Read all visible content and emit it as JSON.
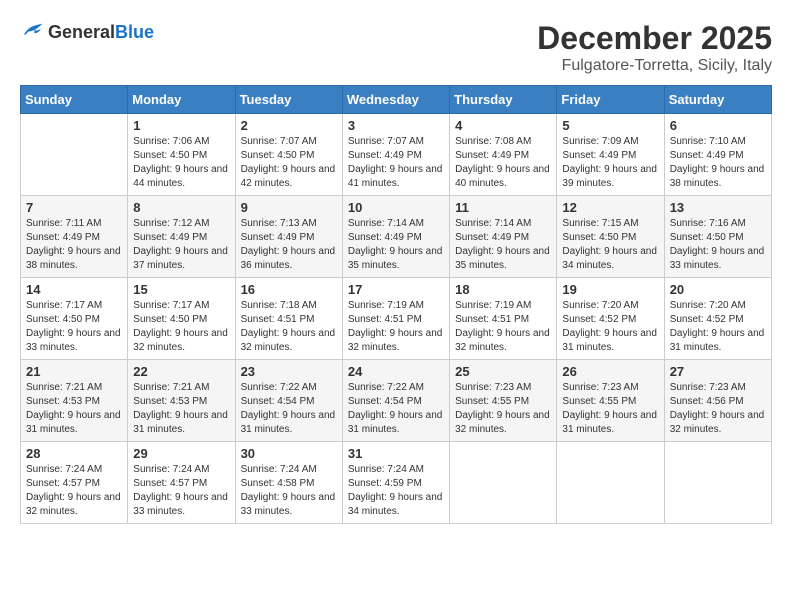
{
  "logo": {
    "general": "General",
    "blue": "Blue"
  },
  "header": {
    "month": "December 2025",
    "location": "Fulgatore-Torretta, Sicily, Italy"
  },
  "days_of_week": [
    "Sunday",
    "Monday",
    "Tuesday",
    "Wednesday",
    "Thursday",
    "Friday",
    "Saturday"
  ],
  "weeks": [
    [
      {
        "day": "",
        "sunrise": "",
        "sunset": "",
        "daylight": ""
      },
      {
        "day": "1",
        "sunrise": "Sunrise: 7:06 AM",
        "sunset": "Sunset: 4:50 PM",
        "daylight": "Daylight: 9 hours and 44 minutes."
      },
      {
        "day": "2",
        "sunrise": "Sunrise: 7:07 AM",
        "sunset": "Sunset: 4:50 PM",
        "daylight": "Daylight: 9 hours and 42 minutes."
      },
      {
        "day": "3",
        "sunrise": "Sunrise: 7:07 AM",
        "sunset": "Sunset: 4:49 PM",
        "daylight": "Daylight: 9 hours and 41 minutes."
      },
      {
        "day": "4",
        "sunrise": "Sunrise: 7:08 AM",
        "sunset": "Sunset: 4:49 PM",
        "daylight": "Daylight: 9 hours and 40 minutes."
      },
      {
        "day": "5",
        "sunrise": "Sunrise: 7:09 AM",
        "sunset": "Sunset: 4:49 PM",
        "daylight": "Daylight: 9 hours and 39 minutes."
      },
      {
        "day": "6",
        "sunrise": "Sunrise: 7:10 AM",
        "sunset": "Sunset: 4:49 PM",
        "daylight": "Daylight: 9 hours and 38 minutes."
      }
    ],
    [
      {
        "day": "7",
        "sunrise": "Sunrise: 7:11 AM",
        "sunset": "Sunset: 4:49 PM",
        "daylight": "Daylight: 9 hours and 38 minutes."
      },
      {
        "day": "8",
        "sunrise": "Sunrise: 7:12 AM",
        "sunset": "Sunset: 4:49 PM",
        "daylight": "Daylight: 9 hours and 37 minutes."
      },
      {
        "day": "9",
        "sunrise": "Sunrise: 7:13 AM",
        "sunset": "Sunset: 4:49 PM",
        "daylight": "Daylight: 9 hours and 36 minutes."
      },
      {
        "day": "10",
        "sunrise": "Sunrise: 7:14 AM",
        "sunset": "Sunset: 4:49 PM",
        "daylight": "Daylight: 9 hours and 35 minutes."
      },
      {
        "day": "11",
        "sunrise": "Sunrise: 7:14 AM",
        "sunset": "Sunset: 4:49 PM",
        "daylight": "Daylight: 9 hours and 35 minutes."
      },
      {
        "day": "12",
        "sunrise": "Sunrise: 7:15 AM",
        "sunset": "Sunset: 4:50 PM",
        "daylight": "Daylight: 9 hours and 34 minutes."
      },
      {
        "day": "13",
        "sunrise": "Sunrise: 7:16 AM",
        "sunset": "Sunset: 4:50 PM",
        "daylight": "Daylight: 9 hours and 33 minutes."
      }
    ],
    [
      {
        "day": "14",
        "sunrise": "Sunrise: 7:17 AM",
        "sunset": "Sunset: 4:50 PM",
        "daylight": "Daylight: 9 hours and 33 minutes."
      },
      {
        "day": "15",
        "sunrise": "Sunrise: 7:17 AM",
        "sunset": "Sunset: 4:50 PM",
        "daylight": "Daylight: 9 hours and 32 minutes."
      },
      {
        "day": "16",
        "sunrise": "Sunrise: 7:18 AM",
        "sunset": "Sunset: 4:51 PM",
        "daylight": "Daylight: 9 hours and 32 minutes."
      },
      {
        "day": "17",
        "sunrise": "Sunrise: 7:19 AM",
        "sunset": "Sunset: 4:51 PM",
        "daylight": "Daylight: 9 hours and 32 minutes."
      },
      {
        "day": "18",
        "sunrise": "Sunrise: 7:19 AM",
        "sunset": "Sunset: 4:51 PM",
        "daylight": "Daylight: 9 hours and 32 minutes."
      },
      {
        "day": "19",
        "sunrise": "Sunrise: 7:20 AM",
        "sunset": "Sunset: 4:52 PM",
        "daylight": "Daylight: 9 hours and 31 minutes."
      },
      {
        "day": "20",
        "sunrise": "Sunrise: 7:20 AM",
        "sunset": "Sunset: 4:52 PM",
        "daylight": "Daylight: 9 hours and 31 minutes."
      }
    ],
    [
      {
        "day": "21",
        "sunrise": "Sunrise: 7:21 AM",
        "sunset": "Sunset: 4:53 PM",
        "daylight": "Daylight: 9 hours and 31 minutes."
      },
      {
        "day": "22",
        "sunrise": "Sunrise: 7:21 AM",
        "sunset": "Sunset: 4:53 PM",
        "daylight": "Daylight: 9 hours and 31 minutes."
      },
      {
        "day": "23",
        "sunrise": "Sunrise: 7:22 AM",
        "sunset": "Sunset: 4:54 PM",
        "daylight": "Daylight: 9 hours and 31 minutes."
      },
      {
        "day": "24",
        "sunrise": "Sunrise: 7:22 AM",
        "sunset": "Sunset: 4:54 PM",
        "daylight": "Daylight: 9 hours and 31 minutes."
      },
      {
        "day": "25",
        "sunrise": "Sunrise: 7:23 AM",
        "sunset": "Sunset: 4:55 PM",
        "daylight": "Daylight: 9 hours and 32 minutes."
      },
      {
        "day": "26",
        "sunrise": "Sunrise: 7:23 AM",
        "sunset": "Sunset: 4:55 PM",
        "daylight": "Daylight: 9 hours and 31 minutes."
      },
      {
        "day": "27",
        "sunrise": "Sunrise: 7:23 AM",
        "sunset": "Sunset: 4:56 PM",
        "daylight": "Daylight: 9 hours and 32 minutes."
      }
    ],
    [
      {
        "day": "28",
        "sunrise": "Sunrise: 7:24 AM",
        "sunset": "Sunset: 4:57 PM",
        "daylight": "Daylight: 9 hours and 32 minutes."
      },
      {
        "day": "29",
        "sunrise": "Sunrise: 7:24 AM",
        "sunset": "Sunset: 4:57 PM",
        "daylight": "Daylight: 9 hours and 33 minutes."
      },
      {
        "day": "30",
        "sunrise": "Sunrise: 7:24 AM",
        "sunset": "Sunset: 4:58 PM",
        "daylight": "Daylight: 9 hours and 33 minutes."
      },
      {
        "day": "31",
        "sunrise": "Sunrise: 7:24 AM",
        "sunset": "Sunset: 4:59 PM",
        "daylight": "Daylight: 9 hours and 34 minutes."
      },
      {
        "day": "",
        "sunrise": "",
        "sunset": "",
        "daylight": ""
      },
      {
        "day": "",
        "sunrise": "",
        "sunset": "",
        "daylight": ""
      },
      {
        "day": "",
        "sunrise": "",
        "sunset": "",
        "daylight": ""
      }
    ]
  ]
}
